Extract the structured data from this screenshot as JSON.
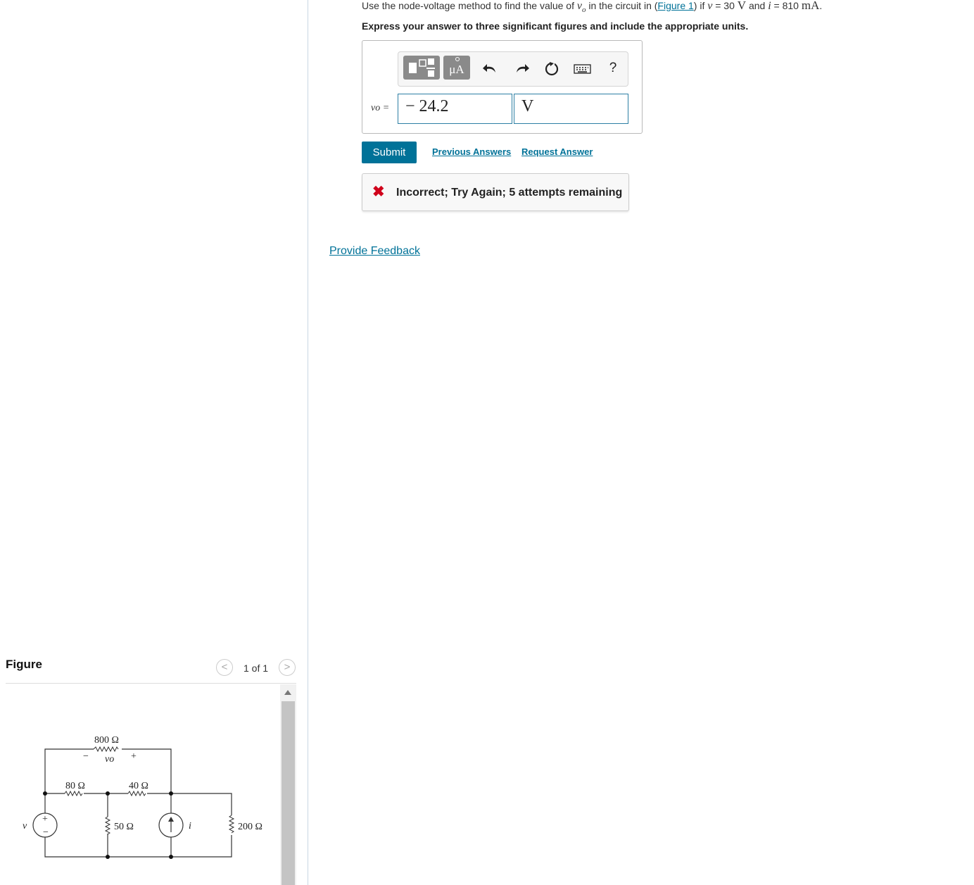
{
  "problem": {
    "text_before": "Use the node-voltage method to find the value of",
    "var_vo": "vo",
    "text_in_circuit": "in the circuit in (",
    "figure_link": "Figure 1",
    "text_if": ") if",
    "var_v": "v",
    "v_value": "= 30",
    "v_unit": "V",
    "text_and": "and",
    "var_i": "i",
    "i_value": "= 810",
    "i_unit": "mA",
    "text_end": ".",
    "instruction": "Express your answer to three significant figures and include the appropriate units."
  },
  "toolbar": {
    "units_label": "μA",
    "help_label": "?"
  },
  "answer": {
    "variable_label": "vo =",
    "value": "− 24.2",
    "unit": "V"
  },
  "actions": {
    "submit": "Submit",
    "previous_answers": "Previous Answers",
    "request_answer": "Request Answer"
  },
  "feedback": {
    "icon": "✖",
    "message": "Incorrect; Try Again; 5 attempts remaining"
  },
  "provide_feedback": "Provide Feedback",
  "figure": {
    "title": "Figure",
    "page_indicator": "1 of 1",
    "labels": {
      "r800": "800 Ω",
      "r80": "80 Ω",
      "r40": "40 Ω",
      "r50": "50 Ω",
      "r200": "200 Ω",
      "vo": "vo",
      "minus": "−",
      "plus": "+",
      "v": "v",
      "i": "i"
    }
  },
  "colors": {
    "accent": "#007298",
    "error": "#d0021b",
    "toolbar_button": "#8a8a8a"
  }
}
